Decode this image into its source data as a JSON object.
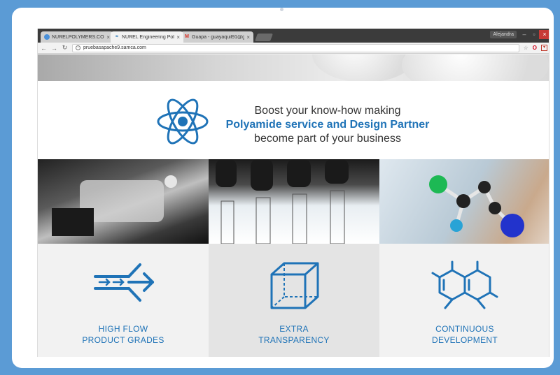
{
  "browser": {
    "tabs": [
      {
        "label": "NURELPOLYMERS.COM",
        "favicon": "globe-icon",
        "active": false
      },
      {
        "label": "NUREL Engineering Poly",
        "favicon": "nurel-icon",
        "active": true
      },
      {
        "label": "Guapa - guayaquil91@g",
        "favicon": "gmail-icon",
        "active": false
      }
    ],
    "tab_close": "×",
    "user": "Alejandra",
    "url": "pruebasapache9.samca.com"
  },
  "hero": {
    "line1": "Boost your know-how making",
    "line2": "Polyamide service and Design Partner",
    "line3": "become part of your business"
  },
  "features": [
    {
      "line1": "HIGH FLOW",
      "line2": "PRODUCT GRADES",
      "icon": "flow-arrows-icon"
    },
    {
      "line1": "EXTRA",
      "line2": "TRANSPARENCY",
      "icon": "cube-icon"
    },
    {
      "line1": "CONTINUOUS",
      "line2": "DEVELOPMENT",
      "icon": "molecule-icon"
    }
  ],
  "colors": {
    "accent": "#1f73b7",
    "background": "#5b9bd5"
  }
}
